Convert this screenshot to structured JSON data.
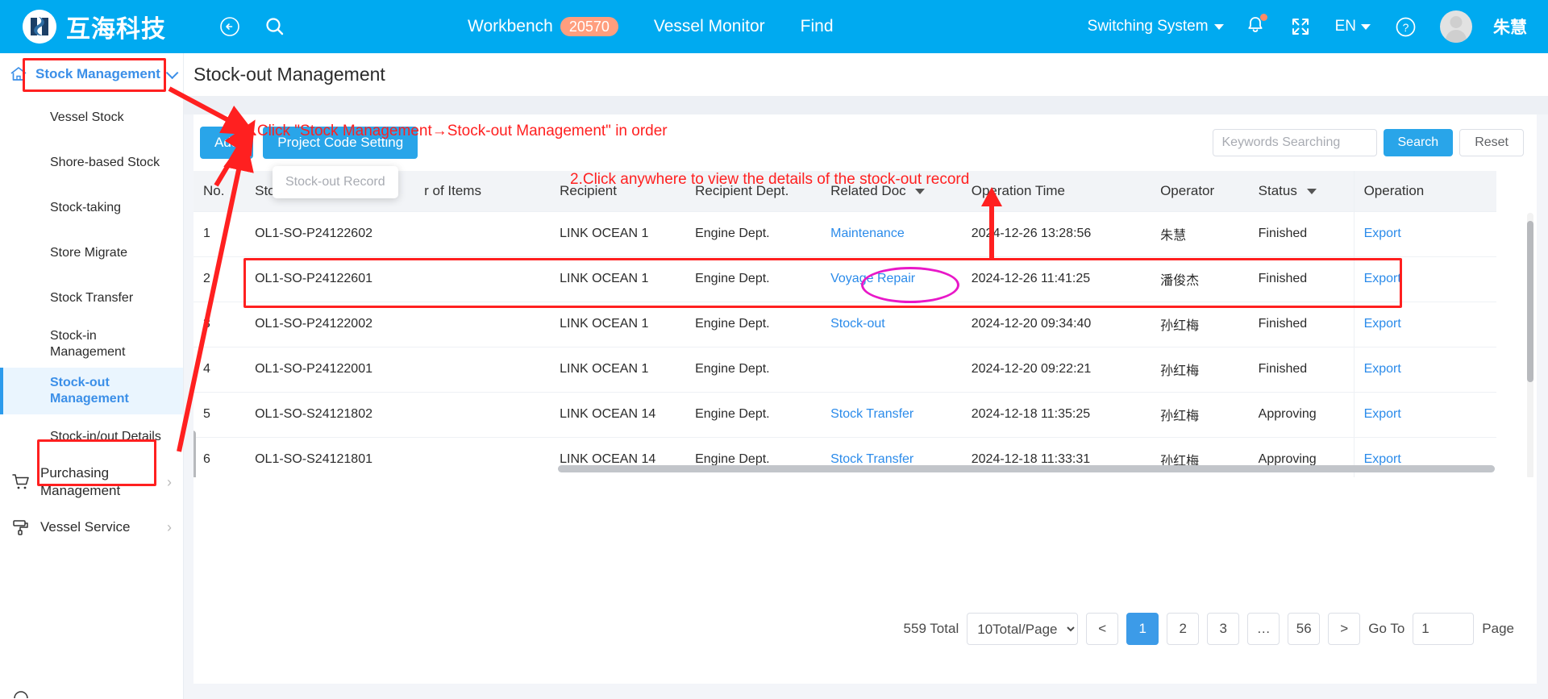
{
  "header": {
    "brand": "互海科技",
    "back_icon": "back-arrow-icon",
    "search_icon": "search-icon",
    "nav": [
      {
        "label": "Workbench",
        "badge": "20570"
      },
      {
        "label": "Vessel Monitor",
        "badge": ""
      },
      {
        "label": "Find",
        "badge": ""
      }
    ],
    "switching_system": "Switching System",
    "language": "EN",
    "username": "朱慧",
    "bell_icon": "bell-icon",
    "fullscreen_icon": "fullscreen-icon",
    "help_icon": "help-circle-icon"
  },
  "sidebar": {
    "home_icon": "home-icon",
    "title": "Stock Management",
    "items": [
      {
        "label": "Vessel Stock",
        "active": false
      },
      {
        "label": "Shore-based Stock",
        "active": false
      },
      {
        "label": "Stock-taking",
        "active": false
      },
      {
        "label": "Store Migrate",
        "active": false
      },
      {
        "label": "Stock Transfer",
        "active": false
      },
      {
        "label": "Stock-in Management",
        "active": false
      },
      {
        "label": "Stock-out Management",
        "active": true
      },
      {
        "label": "Stock-in/out Details",
        "active": false
      }
    ],
    "groups": [
      {
        "label": "Purchasing Management",
        "icon": "cart-icon",
        "arrow": "›"
      },
      {
        "label": "Vessel Service",
        "icon": "paint-roller-icon",
        "arrow": "›"
      }
    ]
  },
  "page": {
    "title": "Stock-out Management"
  },
  "toolbar": {
    "add_label": "Add",
    "project_code_label": "Project Code Setting",
    "search_placeholder": "Keywords Searching",
    "search_value": "",
    "search_label": "Search",
    "reset_label": "Reset"
  },
  "table": {
    "columns": [
      {
        "key": "no",
        "label": "No.",
        "sortable": false
      },
      {
        "key": "record",
        "label": "Stock-out Record",
        "sortable": false
      },
      {
        "key": "items",
        "label": "r of Items",
        "sortable": false
      },
      {
        "key": "recipient",
        "label": "Recipient",
        "sortable": false
      },
      {
        "key": "dept",
        "label": "Recipient Dept.",
        "sortable": false
      },
      {
        "key": "doc",
        "label": "Related Doc",
        "sortable": true
      },
      {
        "key": "time",
        "label": "Operation Time",
        "sortable": false
      },
      {
        "key": "operator",
        "label": "Operator",
        "sortable": false
      },
      {
        "key": "status",
        "label": "Status",
        "sortable": true
      },
      {
        "key": "action",
        "label": "Operation",
        "sortable": false
      }
    ],
    "header_tooltip": "Stock-out Record",
    "rows": [
      {
        "no": "1",
        "record": "OL1-SO-P24122602",
        "items": "",
        "recipient": "LINK OCEAN 1",
        "dept": "Engine Dept.",
        "doc": "Maintenance",
        "time": "2024-12-26 13:28:56",
        "operator": "朱慧",
        "status": "Finished",
        "action": "Export"
      },
      {
        "no": "2",
        "record": "OL1-SO-P24122601",
        "items": "",
        "recipient": "LINK OCEAN 1",
        "dept": "Engine Dept.",
        "doc": "Voyage Repair",
        "time": "2024-12-26 11:41:25",
        "operator": "潘俊杰",
        "status": "Finished",
        "action": "Export"
      },
      {
        "no": "3",
        "record": "OL1-SO-P24122002",
        "items": "",
        "recipient": "LINK OCEAN 1",
        "dept": "Engine Dept.",
        "doc": "Stock-out",
        "time": "2024-12-20 09:34:40",
        "operator": "孙红梅",
        "status": "Finished",
        "action": "Export"
      },
      {
        "no": "4",
        "record": "OL1-SO-P24122001",
        "items": "",
        "recipient": "LINK OCEAN 1",
        "dept": "Engine Dept.",
        "doc": "",
        "time": "2024-12-20 09:22:21",
        "operator": "孙红梅",
        "status": "Finished",
        "action": "Export"
      },
      {
        "no": "5",
        "record": "OL1-SO-S24121802",
        "items": "",
        "recipient": "LINK OCEAN 14",
        "dept": "Engine Dept.",
        "doc": "Stock Transfer",
        "time": "2024-12-18 11:35:25",
        "operator": "孙红梅",
        "status": "Approving",
        "action": "Export"
      },
      {
        "no": "6",
        "record": "OL1-SO-S24121801",
        "items": "",
        "recipient": "LINK OCEAN 14",
        "dept": "Engine Dept.",
        "doc": "Stock Transfer",
        "time": "2024-12-18 11:33:31",
        "operator": "孙红梅",
        "status": "Approving",
        "action": "Export"
      }
    ]
  },
  "pagination": {
    "total_label": "559 Total",
    "page_size": "10Total/Page",
    "prev": "<",
    "pages": [
      "1",
      "2",
      "3",
      "…",
      "56"
    ],
    "active_page": "1",
    "next": ">",
    "goto_label": "Go To",
    "goto_value": "1",
    "page_word": "Page"
  },
  "annotations": {
    "step1": "1.Click \"Stock Management→Stock-out Management\" in order",
    "step2": "2.Click anywhere to view the details of the stock-out record",
    "highlight_color": "#FF2020",
    "ellipse_color": "#E818C8"
  }
}
